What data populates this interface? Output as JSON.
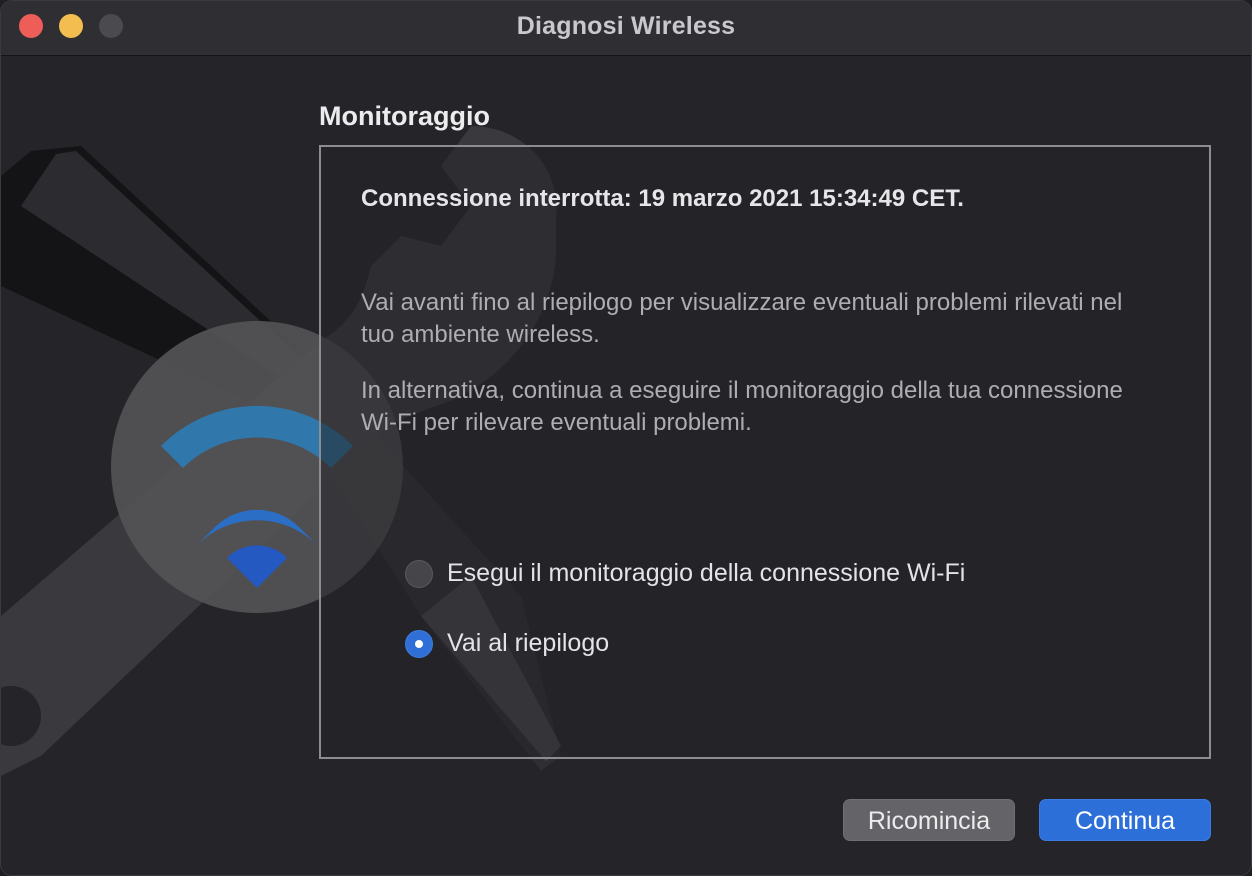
{
  "window": {
    "title": "Diagnosi Wireless"
  },
  "section": {
    "title": "Monitoraggio"
  },
  "panel": {
    "status": "Connessione interrotta: 19 marzo 2021 15:34:49 CET.",
    "paragraph1": "Vai avanti fino al riepilogo per visualizzare eventuali problemi rilevati nel tuo ambiente wireless.",
    "paragraph2": "In alternativa, continua a eseguire il monitoraggio della tua connessione Wi-Fi per rilevare eventuali problemi.",
    "options": [
      {
        "label": "Esegui il monitoraggio della connessione Wi-Fi",
        "selected": false
      },
      {
        "label": "Vai al riepilogo",
        "selected": true
      }
    ]
  },
  "buttons": {
    "restart": "Ricomincia",
    "continue": "Continua"
  },
  "colors": {
    "accent": "#2c6fd8",
    "wifi_icon": "#2f6fd6"
  }
}
